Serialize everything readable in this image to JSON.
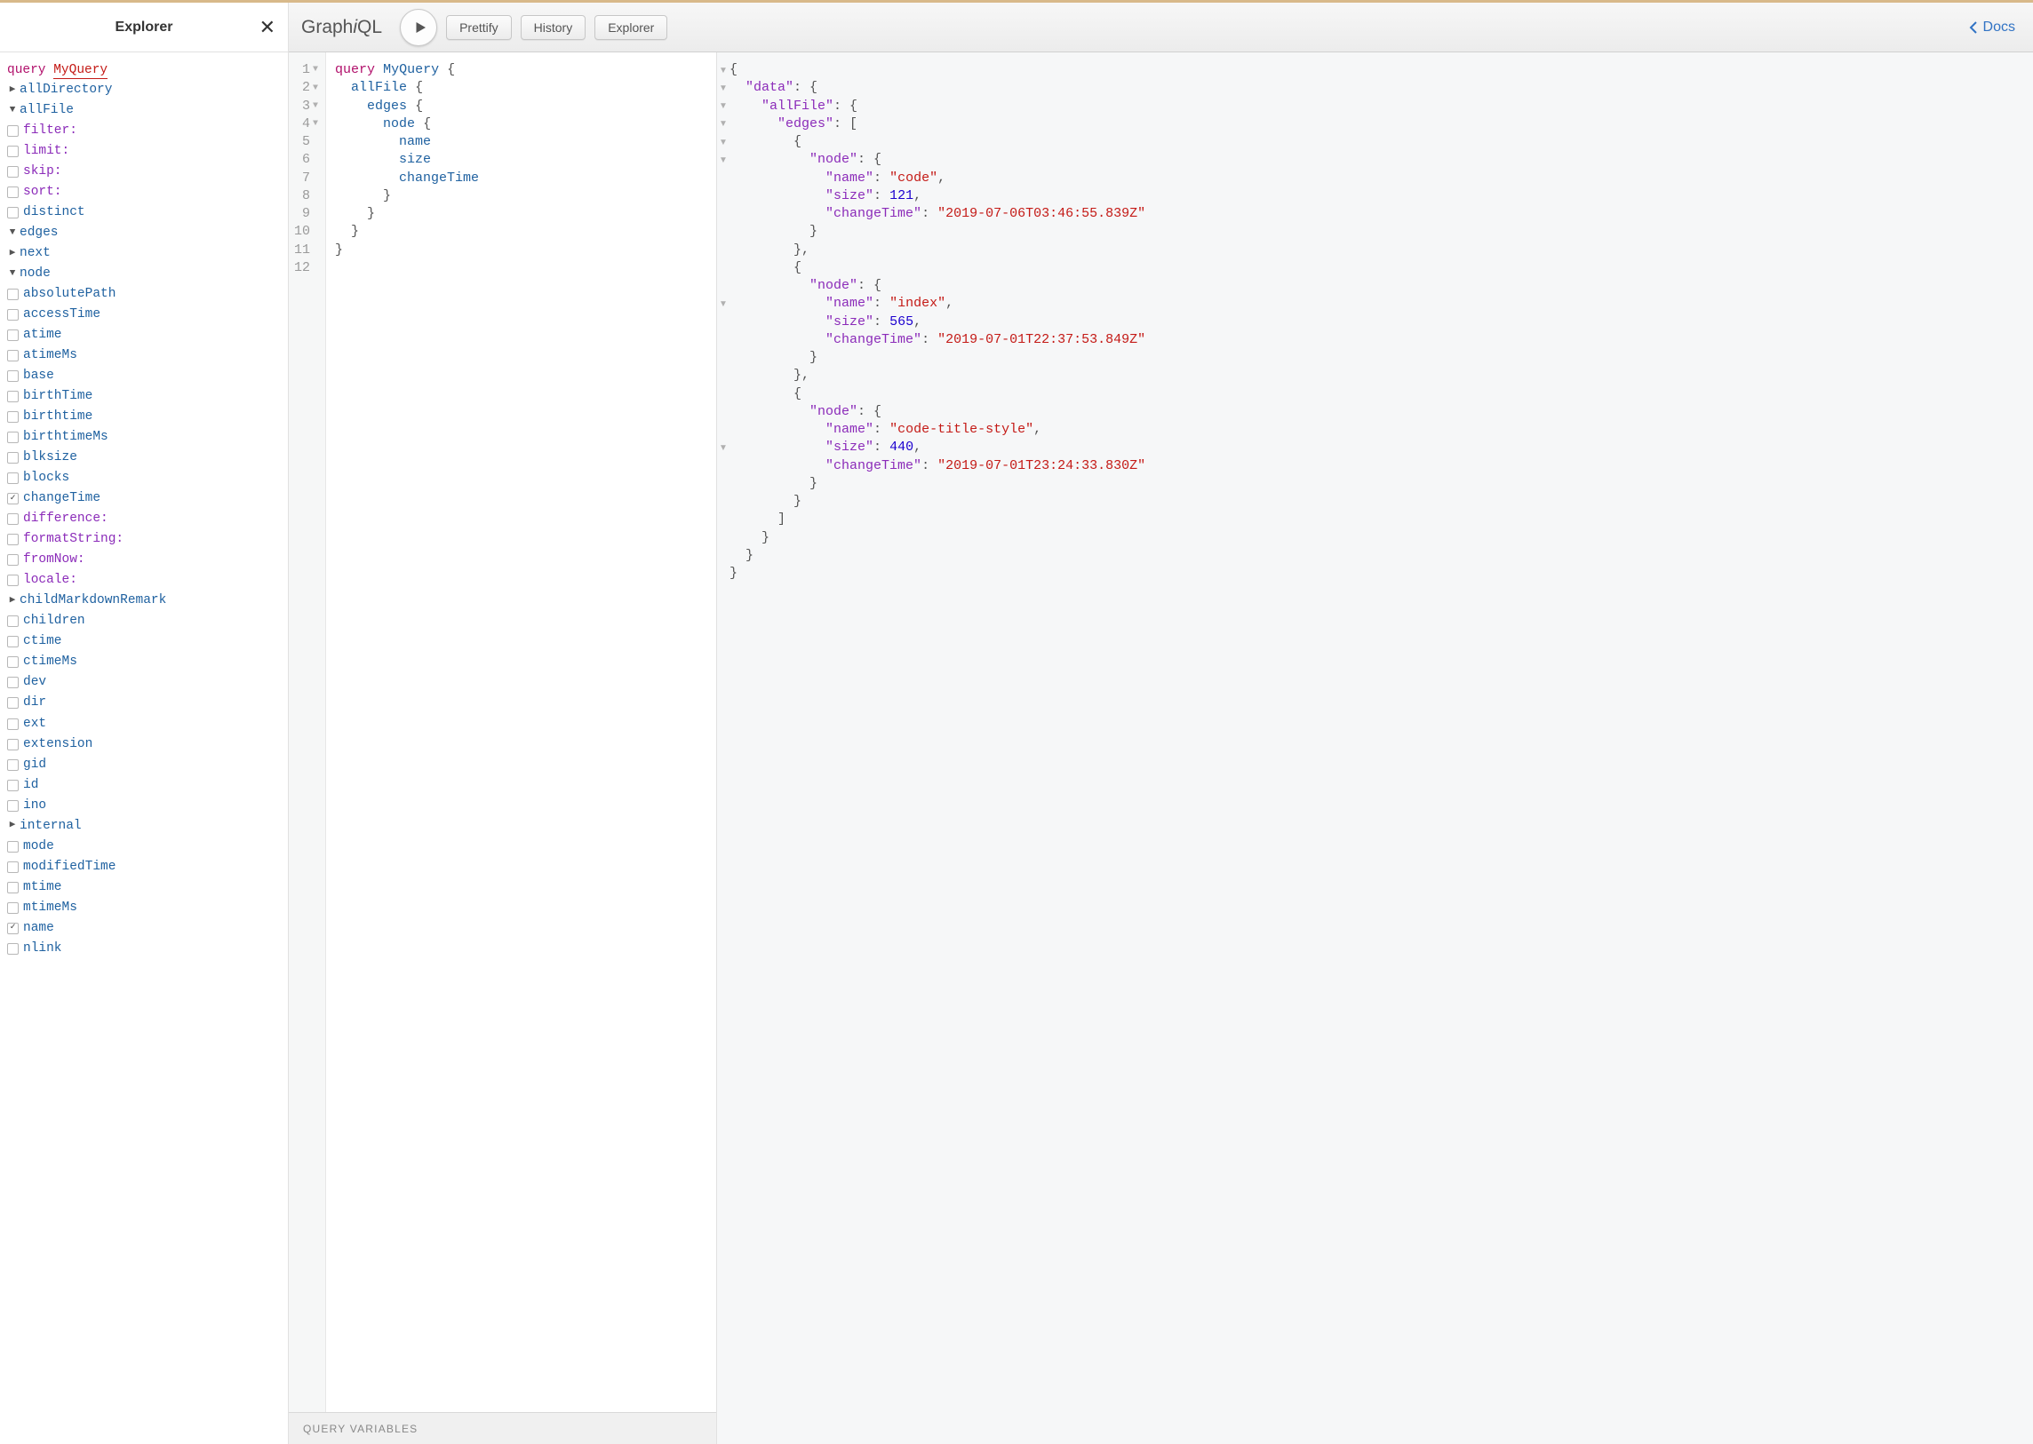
{
  "explorer": {
    "title": "Explorer",
    "query_keyword": "query",
    "query_name": "MyQuery",
    "root": [
      {
        "type": "expand",
        "label": "allDirectory",
        "open": false,
        "indent": 1,
        "cls": "field"
      },
      {
        "type": "expand",
        "label": "allFile",
        "open": true,
        "indent": 1,
        "cls": "field"
      },
      {
        "type": "check",
        "label": "filter:",
        "checked": false,
        "indent": 2,
        "cls": "arg"
      },
      {
        "type": "check",
        "label": "limit:",
        "checked": false,
        "indent": 2,
        "cls": "arg"
      },
      {
        "type": "check",
        "label": "skip:",
        "checked": false,
        "indent": 2,
        "cls": "arg"
      },
      {
        "type": "check",
        "label": "sort:",
        "checked": false,
        "indent": 2,
        "cls": "arg"
      },
      {
        "type": "check",
        "label": "distinct",
        "checked": false,
        "indent": 2,
        "cls": "field"
      },
      {
        "type": "expand",
        "label": "edges",
        "open": true,
        "indent": 2,
        "cls": "field"
      },
      {
        "type": "expand",
        "label": "next",
        "open": false,
        "indent": 3,
        "cls": "field"
      },
      {
        "type": "expand",
        "label": "node",
        "open": true,
        "indent": 3,
        "cls": "field"
      },
      {
        "type": "check",
        "label": "absolutePath",
        "checked": false,
        "indent": 4,
        "cls": "field"
      },
      {
        "type": "check",
        "label": "accessTime",
        "checked": false,
        "indent": 4,
        "cls": "field"
      },
      {
        "type": "check",
        "label": "atime",
        "checked": false,
        "indent": 4,
        "cls": "field"
      },
      {
        "type": "check",
        "label": "atimeMs",
        "checked": false,
        "indent": 4,
        "cls": "field"
      },
      {
        "type": "check",
        "label": "base",
        "checked": false,
        "indent": 4,
        "cls": "field"
      },
      {
        "type": "check",
        "label": "birthTime",
        "checked": false,
        "indent": 4,
        "cls": "field"
      },
      {
        "type": "check",
        "label": "birthtime",
        "checked": false,
        "indent": 4,
        "cls": "field"
      },
      {
        "type": "check",
        "label": "birthtimeMs",
        "checked": false,
        "indent": 4,
        "cls": "field"
      },
      {
        "type": "check",
        "label": "blksize",
        "checked": false,
        "indent": 4,
        "cls": "field"
      },
      {
        "type": "check",
        "label": "blocks",
        "checked": false,
        "indent": 4,
        "cls": "field"
      },
      {
        "type": "check",
        "label": "changeTime",
        "checked": true,
        "indent": 4,
        "cls": "field"
      },
      {
        "type": "check",
        "label": "difference:",
        "checked": false,
        "indent": 5,
        "cls": "arg"
      },
      {
        "type": "check",
        "label": "formatString:",
        "checked": false,
        "indent": 5,
        "cls": "arg"
      },
      {
        "type": "check",
        "label": "fromNow:",
        "checked": false,
        "indent": 5,
        "cls": "arg"
      },
      {
        "type": "check",
        "label": "locale:",
        "checked": false,
        "indent": 5,
        "cls": "arg"
      },
      {
        "type": "expand",
        "label": "childMarkdownRemark",
        "open": false,
        "indent": 4,
        "cls": "field"
      },
      {
        "type": "check",
        "label": "children",
        "checked": false,
        "indent": 4,
        "cls": "field"
      },
      {
        "type": "check",
        "label": "ctime",
        "checked": false,
        "indent": 4,
        "cls": "field"
      },
      {
        "type": "check",
        "label": "ctimeMs",
        "checked": false,
        "indent": 4,
        "cls": "field"
      },
      {
        "type": "check",
        "label": "dev",
        "checked": false,
        "indent": 4,
        "cls": "field"
      },
      {
        "type": "check",
        "label": "dir",
        "checked": false,
        "indent": 4,
        "cls": "field"
      },
      {
        "type": "check",
        "label": "ext",
        "checked": false,
        "indent": 4,
        "cls": "field"
      },
      {
        "type": "check",
        "label": "extension",
        "checked": false,
        "indent": 4,
        "cls": "field"
      },
      {
        "type": "check",
        "label": "gid",
        "checked": false,
        "indent": 4,
        "cls": "field"
      },
      {
        "type": "check",
        "label": "id",
        "checked": false,
        "indent": 4,
        "cls": "field"
      },
      {
        "type": "check",
        "label": "ino",
        "checked": false,
        "indent": 4,
        "cls": "field"
      },
      {
        "type": "expand",
        "label": "internal",
        "open": false,
        "indent": 4,
        "cls": "field"
      },
      {
        "type": "check",
        "label": "mode",
        "checked": false,
        "indent": 4,
        "cls": "field"
      },
      {
        "type": "check",
        "label": "modifiedTime",
        "checked": false,
        "indent": 4,
        "cls": "field"
      },
      {
        "type": "check",
        "label": "mtime",
        "checked": false,
        "indent": 4,
        "cls": "field"
      },
      {
        "type": "check",
        "label": "mtimeMs",
        "checked": false,
        "indent": 4,
        "cls": "field"
      },
      {
        "type": "check",
        "label": "name",
        "checked": true,
        "indent": 4,
        "cls": "field"
      },
      {
        "type": "check",
        "label": "nlink",
        "checked": false,
        "indent": 4,
        "cls": "field"
      }
    ]
  },
  "toolbar": {
    "brand_a": "Graph",
    "brand_b": "i",
    "brand_c": "QL",
    "prettify": "Prettify",
    "history": "History",
    "explorer": "Explorer",
    "docs": "Docs"
  },
  "editor": {
    "lines": [
      {
        "n": 1,
        "fold": true,
        "html": "<span class='tok-kw'>query</span> <span class='tok-def'>MyQuery</span> <span class='tok-brace'>{</span>"
      },
      {
        "n": 2,
        "fold": true,
        "html": "  <span class='tok-field'>allFile</span> <span class='tok-brace'>{</span>"
      },
      {
        "n": 3,
        "fold": true,
        "html": "    <span class='tok-field'>edges</span> <span class='tok-brace'>{</span>"
      },
      {
        "n": 4,
        "fold": true,
        "html": "      <span class='tok-field'>node</span> <span class='tok-brace'>{</span>"
      },
      {
        "n": 5,
        "fold": false,
        "html": "        <span class='tok-field'>name</span>"
      },
      {
        "n": 6,
        "fold": false,
        "html": "        <span class='tok-field'>size</span>"
      },
      {
        "n": 7,
        "fold": false,
        "html": "        <span class='tok-field'>changeTime</span>"
      },
      {
        "n": 8,
        "fold": false,
        "html": "      <span class='tok-brace'>}</span>"
      },
      {
        "n": 9,
        "fold": false,
        "html": "    <span class='tok-brace'>}</span>"
      },
      {
        "n": 10,
        "fold": false,
        "html": "  <span class='tok-brace'>}</span>"
      },
      {
        "n": 11,
        "fold": false,
        "html": "<span class='tok-brace'>}</span>"
      },
      {
        "n": 12,
        "fold": false,
        "html": ""
      }
    ],
    "qvars": "Query Variables"
  },
  "result": {
    "fold_rows": [
      1,
      2,
      3,
      4,
      5,
      6,
      0,
      0,
      0,
      0,
      0,
      0,
      0,
      1,
      0,
      0,
      0,
      0,
      0,
      0,
      0,
      1,
      0,
      0,
      0,
      0,
      0
    ],
    "data": {
      "allFile": {
        "edges": [
          {
            "node": {
              "name": "code",
              "size": 121,
              "changeTime": "2019-07-06T03:46:55.839Z"
            }
          },
          {
            "node": {
              "name": "index",
              "size": 565,
              "changeTime": "2019-07-01T22:37:53.849Z"
            }
          },
          {
            "node": {
              "name": "code-title-style",
              "size": 440,
              "changeTime": "2019-07-01T23:24:33.830Z"
            }
          }
        ]
      }
    }
  }
}
